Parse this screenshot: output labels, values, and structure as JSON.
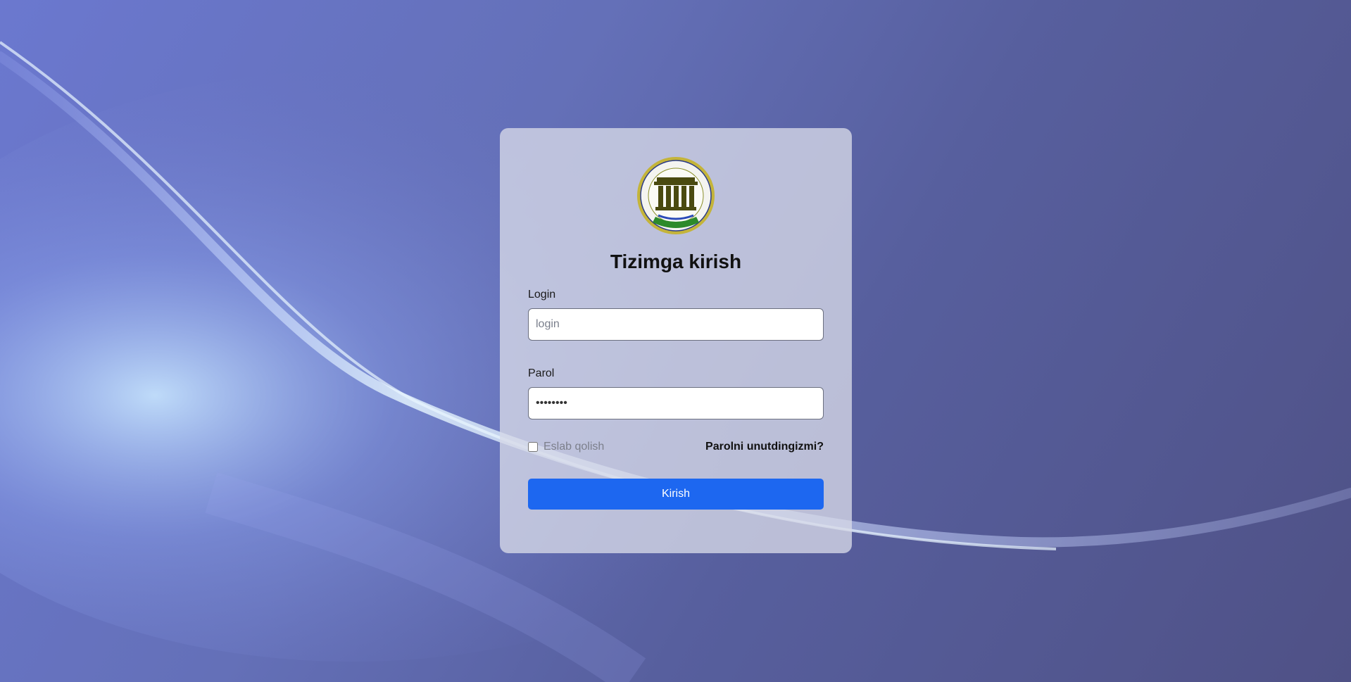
{
  "page": {
    "title": "Tizimga kirish"
  },
  "form": {
    "login_label": "Login",
    "login_placeholder": "login",
    "password_label": "Parol",
    "password_value": "password",
    "remember_label": "Eslab qolish",
    "forgot_label": "Parolni unutdingizmi?",
    "submit_label": "Kirish"
  },
  "logo": {
    "icon": "university-seal-icon",
    "seal_text": "TOSHKENT ARXITEKTURA TEXNOLOGIYALARI UNIVERSITETI"
  },
  "colors": {
    "accent": "#1d67f0",
    "card_bg": "#d7dae8",
    "background": "#5f68b0"
  }
}
